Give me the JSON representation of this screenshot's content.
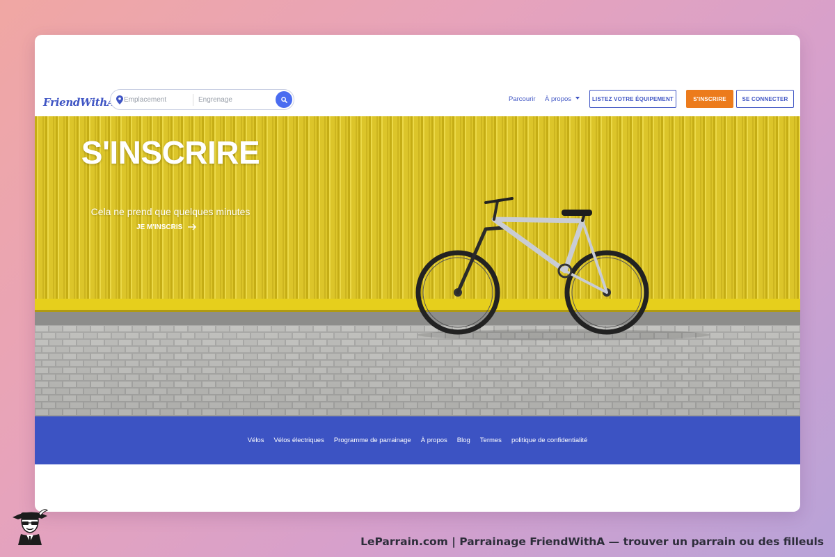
{
  "header": {
    "logo_text": "FriendWithA",
    "logo_dots": "...",
    "search": {
      "location_placeholder": "Emplacement",
      "gear_placeholder": "Engrenage"
    },
    "nav": {
      "browse": "Parcourir",
      "about": "À propos"
    },
    "buttons": {
      "list_equipment": "LISTEZ VOTRE ÉQUIPEMENT",
      "signup": "S'INSCRIRE",
      "login": "SE CONNECTER"
    }
  },
  "hero": {
    "title": "S'INSCRIRE",
    "subtitle": "Cela ne prend que quelques minutes",
    "cta": "JE M'INSCRIS"
  },
  "footer": {
    "links": [
      "Vélos",
      "Vélos électriques",
      "Programme de parrainage",
      "À propos",
      "Blog",
      "Termes",
      "politique de confidentialité"
    ]
  },
  "watermark": {
    "caption": "LeParrain.com | Parrainage FriendWithA — trouver un parrain ou des filleuls"
  },
  "colors": {
    "brand_blue": "#3f55c4",
    "footer_blue": "#3c53c3",
    "signup_orange": "#ec7b1c",
    "search_button": "#4a6cf0",
    "wall_yellow": "#dbc72c"
  },
  "icons": {
    "search_pin": "location-pin-icon",
    "search_button": "search-icon",
    "cta_arrow": "arrow-right-icon",
    "about_caret": "caret-down-icon"
  }
}
